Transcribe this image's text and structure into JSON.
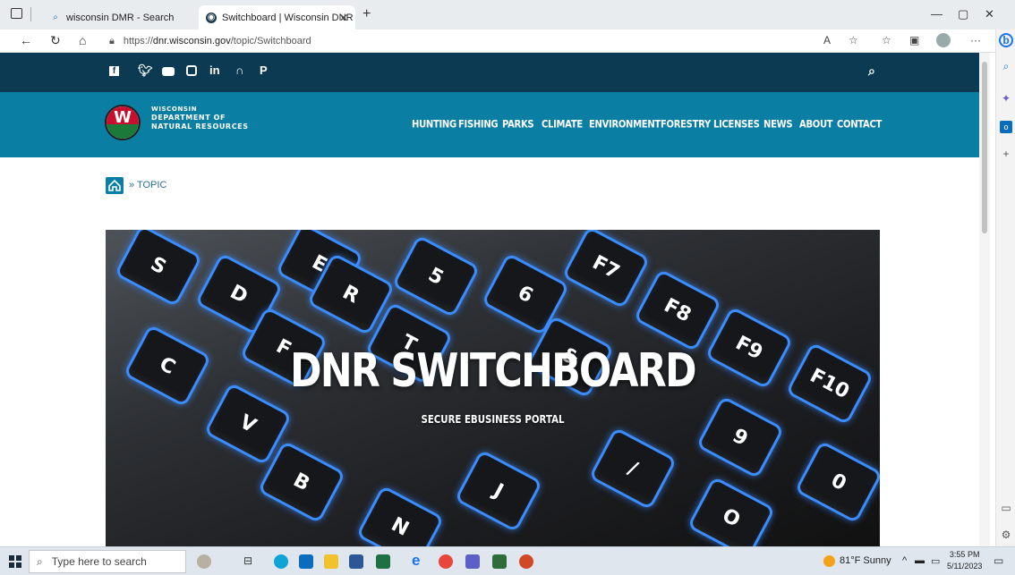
{
  "browser": {
    "tabs": [
      {
        "label": "wisconsin DMR - Search",
        "icon": "search-icon"
      },
      {
        "label": "Switchboard | Wisconsin DNR",
        "icon": "globe-icon"
      }
    ],
    "url_prefix": "https://",
    "url_host": "dnr.wisconsin.gov",
    "url_path": "/topic/Switchboard"
  },
  "site": {
    "social": [
      "f",
      "t",
      "yt",
      "ig",
      "in",
      "rss",
      "p"
    ],
    "logo": {
      "line1": "WISCONSIN",
      "line2": "DEPARTMENT OF",
      "line3": "NATURAL RESOURCES"
    },
    "nav": [
      "HUNTING",
      "FISHING",
      "PARKS",
      "CLIMATE",
      "ENVIRONMENT",
      "FORESTRY",
      "LICENSES",
      "NEWS",
      "ABOUT",
      "CONTACT"
    ],
    "breadcrumb": "» TOPIC",
    "hero": {
      "title": "DNR SWITCHBOARD",
      "subtitle": "SECURE EBUSINESS PORTAL"
    }
  },
  "taskbar": {
    "search_placeholder": "Type here to search",
    "weather": "81°F  Sunny",
    "time": "3:55 PM",
    "date": "5/11/2023"
  },
  "colors": {
    "header_dark": "#0b3a52",
    "nav_blue": "#0a7ea3",
    "key_glow": "#3a8cff"
  }
}
